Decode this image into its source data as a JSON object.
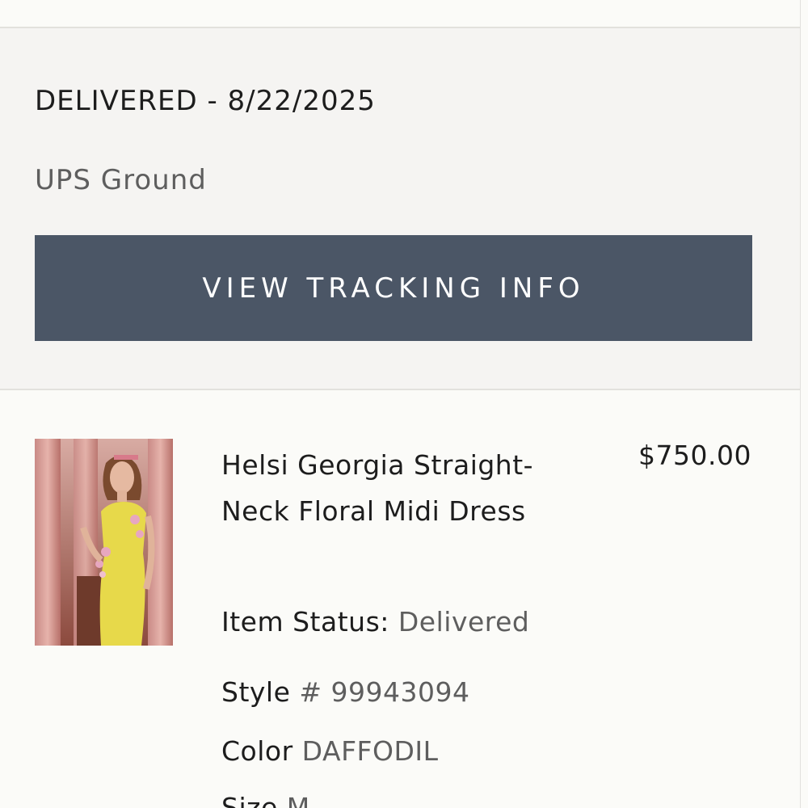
{
  "shipment": {
    "status_heading": "DELIVERED - 8/22/2025",
    "carrier": "UPS Ground",
    "tracking_button_label": "VIEW TRACKING INFO"
  },
  "item": {
    "image_icon": "product-photo-yellow-floral-dress",
    "name": "Helsi Georgia Straight-Neck Floral Midi Dress",
    "price": "$750.00",
    "status_label": "Item Status:",
    "status_value": "Delivered",
    "style_label": "Style",
    "style_value": "# 99943094",
    "color_label": "Color",
    "color_value": "DAFFODIL",
    "size_label": "Size",
    "size_value": "M"
  },
  "colors": {
    "button_bg": "#4b5666",
    "panel_bg": "#f5f4f2",
    "page_bg": "#fbfbf8"
  }
}
